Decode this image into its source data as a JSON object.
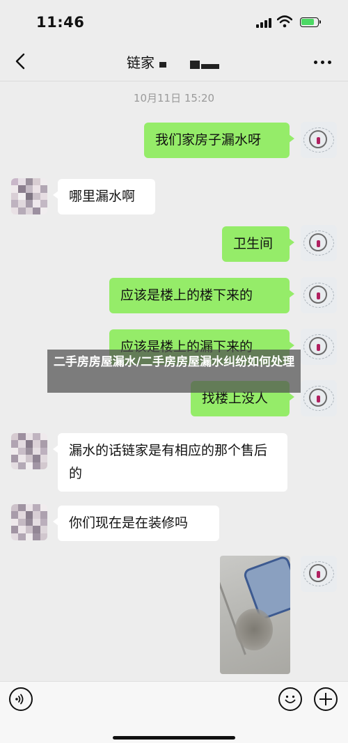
{
  "status_bar": {
    "time": "11:46"
  },
  "chat": {
    "title": "链家",
    "timestamp": "10月11日 15:20",
    "messages": [
      {
        "from": "me",
        "text": "我们家房子漏水呀"
      },
      {
        "from": "other",
        "text": "哪里漏水啊"
      },
      {
        "from": "me",
        "text": "卫生间"
      },
      {
        "from": "me",
        "text": "应该是楼上的楼下来的"
      },
      {
        "from": "me",
        "text": "应该是楼上的漏下来的"
      },
      {
        "from": "me",
        "text": "找楼上没人"
      },
      {
        "from": "other",
        "text": "漏水的话链家是有相应的那个售后的"
      },
      {
        "from": "other",
        "text": "你们现在是在装修吗"
      },
      {
        "from": "me",
        "type": "image"
      }
    ]
  },
  "overlay": {
    "caption": "二手房房屋漏水/二手房房屋漏水纠纷如何处理"
  },
  "icons": {
    "back": "chevron-left-icon",
    "more": "more-icon",
    "voice": "voice-icon",
    "emoji": "emoji-icon",
    "plus": "plus-icon"
  },
  "colors": {
    "my_bubble": "#95ec69",
    "other_bubble": "#ffffff",
    "background": "#ededed"
  }
}
